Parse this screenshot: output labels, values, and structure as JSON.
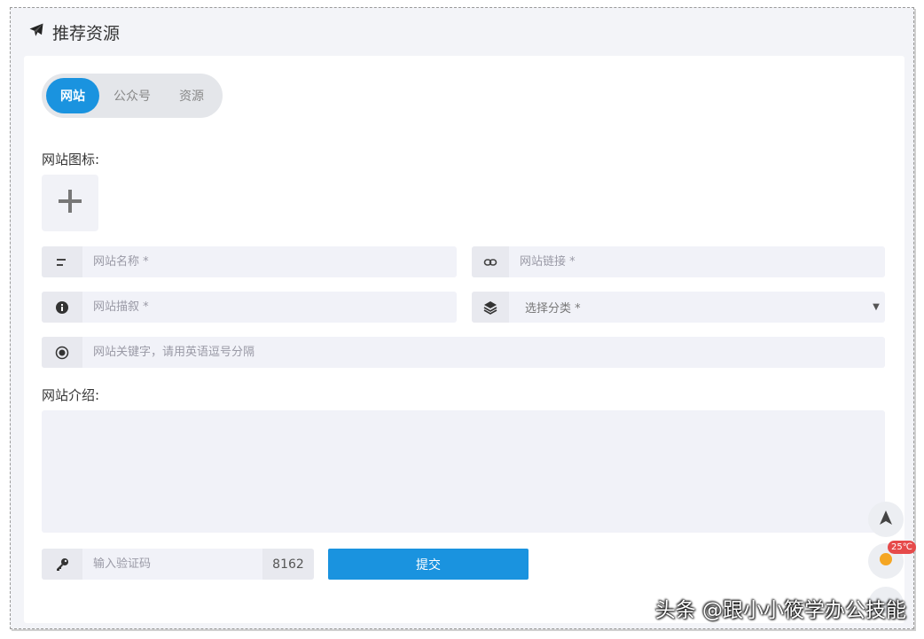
{
  "header": {
    "title": "推荐资源",
    "icon": "paper-plane-icon"
  },
  "tabs": [
    {
      "label": "网站",
      "active": true
    },
    {
      "label": "公众号",
      "active": false
    },
    {
      "label": "资源",
      "active": false
    }
  ],
  "form": {
    "icon_label": "网站图标:",
    "name_placeholder": "网站名称 *",
    "url_placeholder": "网站链接 *",
    "desc_placeholder": "网站描叙 *",
    "category_placeholder": "选择分类 *",
    "keywords_placeholder": "网站关键字，请用英语逗号分隔",
    "intro_label": "网站介绍:",
    "captcha_placeholder": "输入验证码",
    "captcha_code": "8162",
    "submit_label": "提交"
  },
  "floating": {
    "temperature": "25℃"
  },
  "watermark": "头条 @跟小小筱学办公技能",
  "colors": {
    "accent": "#1a93df",
    "field_bg": "#f1f2f8",
    "page_bg": "#f3f4f8"
  }
}
